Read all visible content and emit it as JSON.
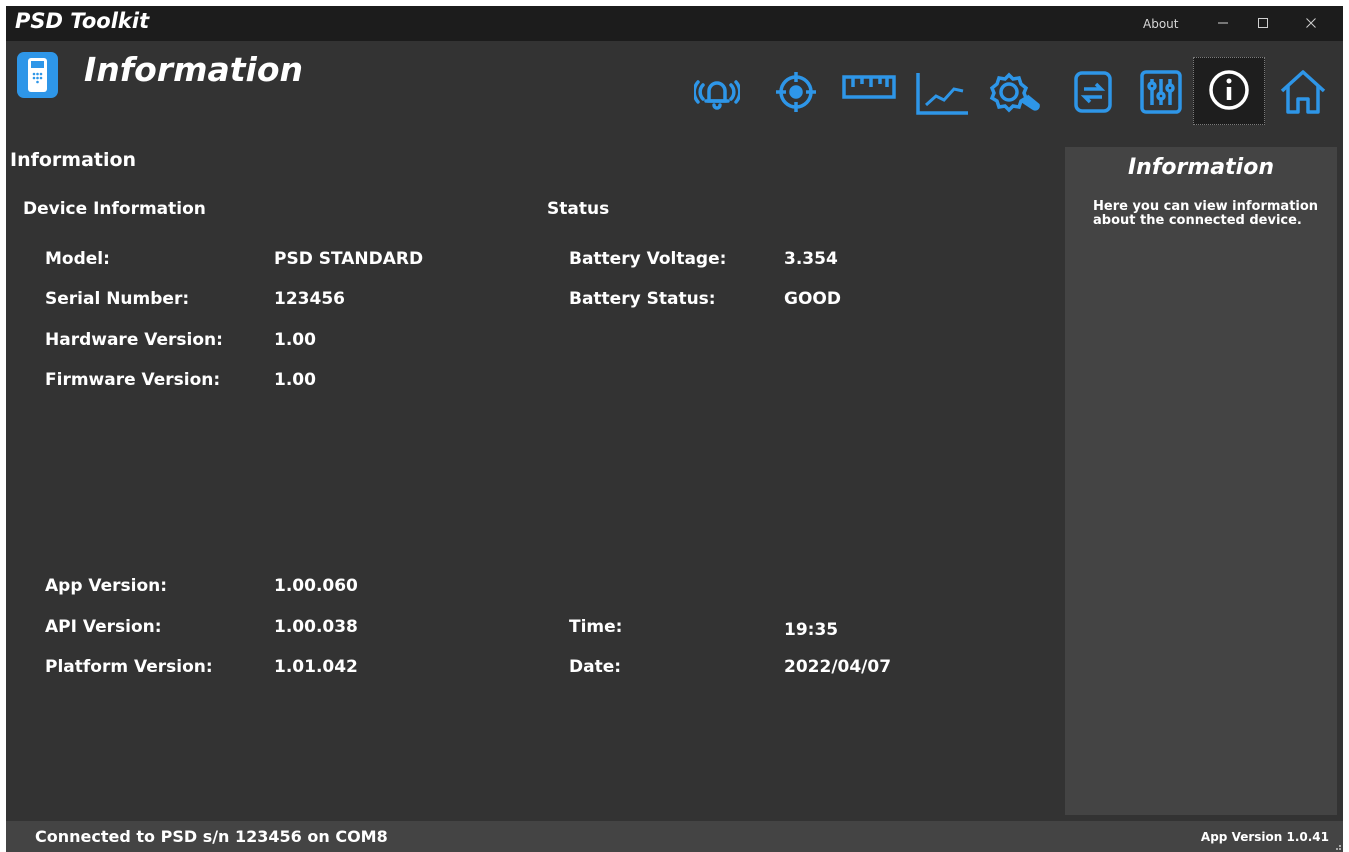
{
  "titlebar": {
    "app_title": "PSD Toolkit",
    "about": "About"
  },
  "header": {
    "page_heading": "Information",
    "icons": [
      "alarm-icon",
      "target-icon",
      "ruler-icon",
      "chart-icon",
      "settings-wrench-icon",
      "file-transfer-icon",
      "sliders-icon",
      "info-icon",
      "home-icon"
    ],
    "active_icon": "info-icon",
    "accent": "#2e96e8"
  },
  "main": {
    "section_title": "Information",
    "device_info": {
      "title": "Device Information",
      "rows": [
        {
          "label": "Model:",
          "value": "PSD STANDARD"
        },
        {
          "label": "Serial Number:",
          "value": "123456"
        },
        {
          "label": "Hardware Version:",
          "value": "1.00"
        },
        {
          "label": "Firmware Version:",
          "value": "1.00"
        }
      ]
    },
    "versions": [
      {
        "label": "App Version:",
        "value": "1.00.060"
      },
      {
        "label": "API Version:",
        "value": "1.00.038"
      },
      {
        "label": "Platform Version:",
        "value": "1.01.042"
      }
    ],
    "status": {
      "title": "Status",
      "rows": [
        {
          "label": "Battery Voltage:",
          "value": "3.354"
        },
        {
          "label": "Battery Status:",
          "value": "GOOD"
        }
      ]
    },
    "time": {
      "label": "Time:",
      "value": "19:35"
    },
    "date": {
      "label": "Date:",
      "value": "2022/04/07"
    }
  },
  "side_panel": {
    "title": "Information",
    "text": "Here you can view information about the connected device."
  },
  "statusbar": {
    "connection": "Connected to PSD s/n 123456 on COM8",
    "app_version": "App Version 1.0.41"
  }
}
